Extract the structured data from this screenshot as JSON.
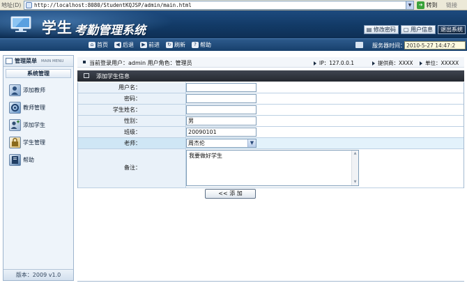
{
  "browser": {
    "address_label": "地址(D)",
    "url": "http://localhost:8080/StudentKQJSP/admin/main.html",
    "go_label": "转到",
    "links_label": "链接"
  },
  "banner": {
    "title_part1": "学生",
    "title_part2": "考勤管理系统",
    "buttons": {
      "change_password": "修改密码",
      "user_info": "用户信息",
      "logout": "退出系统"
    }
  },
  "toolbar": {
    "items": [
      {
        "label": "首页",
        "icon": "home-icon"
      },
      {
        "label": "后退",
        "icon": "back-icon"
      },
      {
        "label": "前进",
        "icon": "forward-icon"
      },
      {
        "label": "刷新",
        "icon": "refresh-icon"
      },
      {
        "label": "帮助",
        "icon": "help-icon"
      }
    ],
    "server_time_label": "服务器时间：",
    "server_time_value": "2010-5-27 14:47:2"
  },
  "sidebar": {
    "title": "管理菜单",
    "title_en": "MAIN MENU",
    "section": "系统管理",
    "items": [
      {
        "label": "添加教师",
        "icon": "add-teacher-icon"
      },
      {
        "label": "教师管理",
        "icon": "teacher-manage-icon"
      },
      {
        "label": "添加学生",
        "icon": "add-student-icon"
      },
      {
        "label": "学生管理",
        "icon": "student-manage-icon"
      },
      {
        "label": "帮助",
        "icon": "help-icon"
      }
    ],
    "version": "版本：2009 v1.0"
  },
  "infobar": {
    "current_user": "当前登录用户：admin  用户角色：管理员",
    "ip": "IP：127.0.0.1",
    "provider": "提供商：XXXX",
    "unit": "单位：XXXXX"
  },
  "form": {
    "title": "添加学生信息",
    "fields": {
      "username": {
        "label": "用户名：",
        "value": ""
      },
      "password": {
        "label": "密码：",
        "value": ""
      },
      "student_name": {
        "label": "学生姓名：",
        "value": ""
      },
      "gender": {
        "label": "性别：",
        "value": "男"
      },
      "class": {
        "label": "班级：",
        "value": "20090101"
      },
      "teacher": {
        "label": "老师：",
        "value": "周杰伦"
      },
      "remark": {
        "label": "备注：",
        "value": "我要做好学生"
      }
    },
    "submit_label": "<< 添 加"
  },
  "colors": {
    "banner": "#123a66",
    "toolbar": "#17406c",
    "panel_header": "#2d3238",
    "highlight_row": "#cfe6f5"
  }
}
